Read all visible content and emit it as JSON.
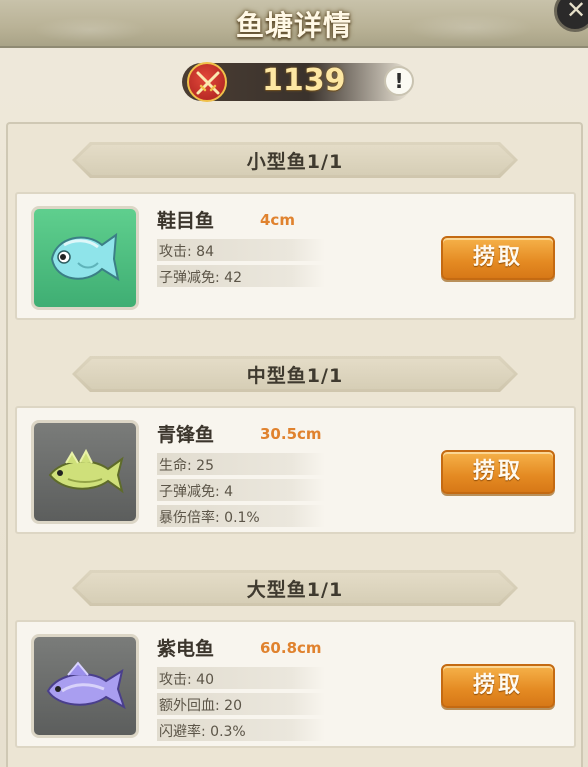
{
  "header": {
    "title": "鱼塘详情",
    "close_icon": "close-icon"
  },
  "power": {
    "value": "1139",
    "icon": "crossed-swords-icon",
    "info_label": "!"
  },
  "sections": [
    {
      "title": "小型鱼1/1",
      "fish": {
        "name": "鞋目鱼",
        "size": "4cm",
        "stats": [
          "攻击: 84",
          "子弹减免: 42"
        ],
        "button": "捞取",
        "theme": "#4fbf80"
      }
    },
    {
      "title": "中型鱼1/1",
      "fish": {
        "name": "青锋鱼",
        "size": "30.5cm",
        "stats": [
          "生命: 25",
          "子弹减免: 4",
          "暴伤倍率: 0.1%"
        ],
        "button": "捞取",
        "theme": "#6b6d6c"
      }
    },
    {
      "title": "大型鱼1/1",
      "fish": {
        "name": "紫电鱼",
        "size": "60.8cm",
        "stats": [
          "攻击: 40",
          "额外回血: 20",
          "闪避率: 0.3%"
        ],
        "button": "捞取",
        "theme": "#6b6d6c"
      }
    }
  ]
}
